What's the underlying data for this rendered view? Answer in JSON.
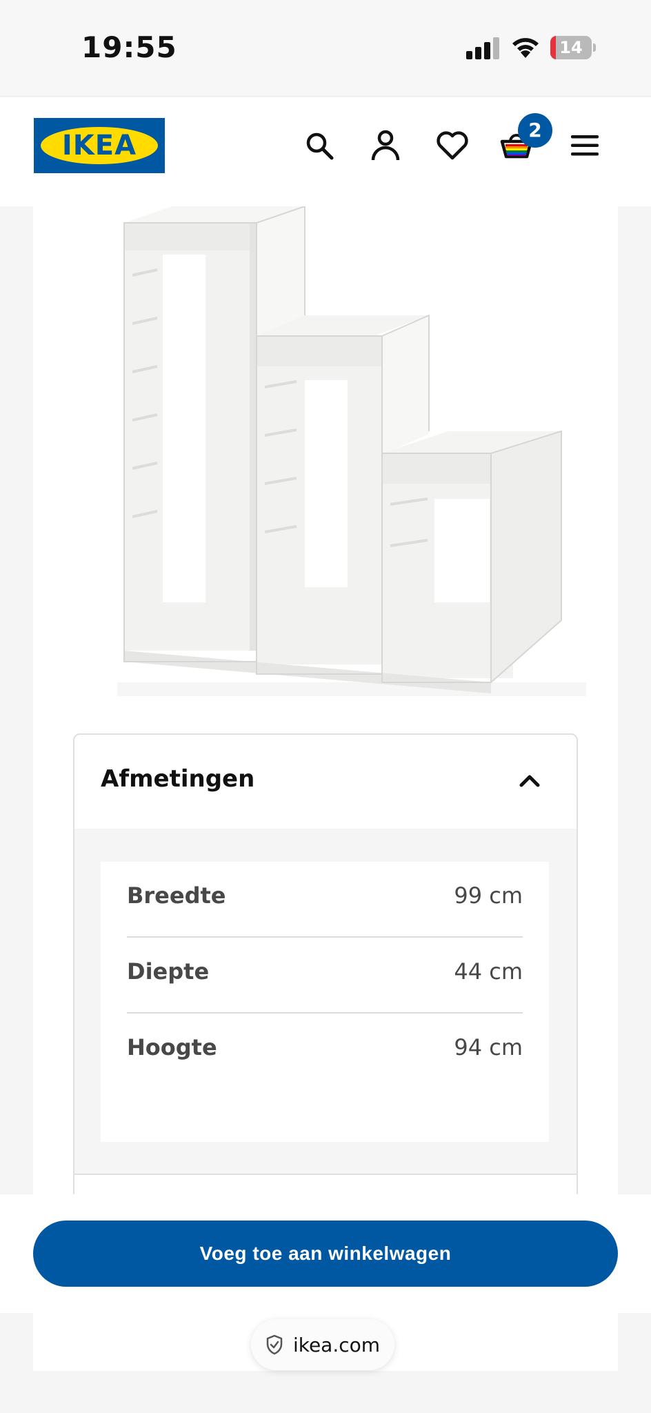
{
  "status_bar": {
    "time": "19:55",
    "battery_level": "14",
    "battery_fraction": 0.14,
    "battery_color": "#e5333d"
  },
  "header": {
    "logo_text": "IKEA",
    "brand_blue": "#0058a3",
    "brand_yellow": "#ffdb00",
    "icons": [
      "search-icon",
      "profile-icon",
      "heart-icon",
      "cart-icon",
      "menu-icon"
    ],
    "cart_count": "2"
  },
  "product": {
    "image": "white-stepped-storage-frame"
  },
  "dimensions": {
    "title": "Afmetingen",
    "rows": [
      {
        "label": "Breedte",
        "value": "99 cm"
      },
      {
        "label": "Diepte",
        "value": "44 cm"
      },
      {
        "label": "Hoogte",
        "value": "94 cm"
      }
    ]
  },
  "actions": {
    "add_to_cart": "Voeg toe aan winkelwagen"
  },
  "browser": {
    "url": "ikea.com"
  }
}
